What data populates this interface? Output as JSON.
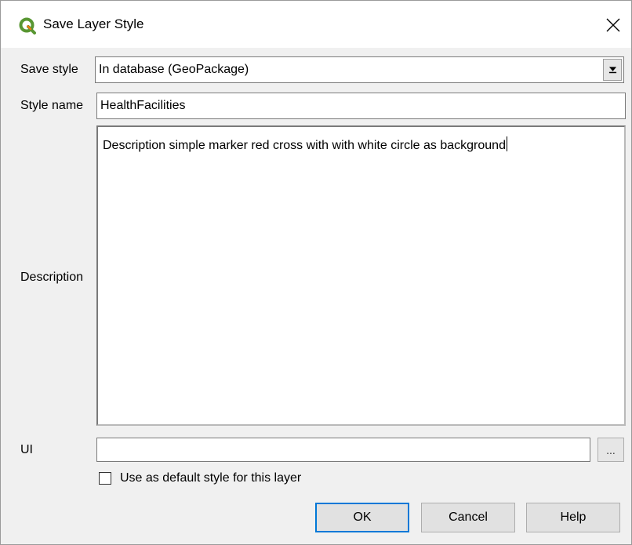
{
  "window": {
    "title": "Save Layer Style",
    "icon": "qgis-logo-icon",
    "close_icon": "close-icon"
  },
  "form": {
    "save_style_label": "Save style",
    "save_style_value": "In database (GeoPackage)",
    "style_name_label": "Style name",
    "style_name_value": "HealthFacilities",
    "description_label": "Description",
    "description_value": "Description simple marker red cross with with white circle as background",
    "ui_label": "UI",
    "ui_value": "",
    "browse_label": "...",
    "default_checkbox_label": "Use as default style for this layer",
    "default_checked": false
  },
  "buttons": {
    "ok": "OK",
    "cancel": "Cancel",
    "help": "Help"
  },
  "colors": {
    "accent": "#0078d7",
    "qgis_green": "#589632",
    "qgis_yellow": "#ee7913"
  }
}
